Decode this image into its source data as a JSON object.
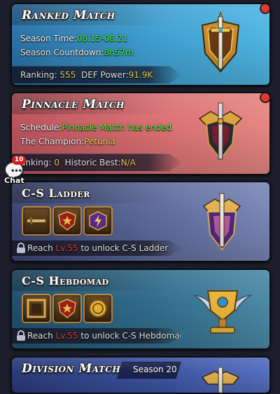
{
  "ranked": {
    "title": "Ranked Match",
    "season_time_label": "Season Time:",
    "season_time_value": "08.15-08.21",
    "countdown_label": "Season Countdown:",
    "countdown_value": "8h57m",
    "ranking_label": "Ranking:",
    "ranking_value": "555",
    "def_label": "DEF Power:",
    "def_value": "91.9K"
  },
  "pinnacle": {
    "title": "Pinnacle Match",
    "schedule_label": "Schedule:",
    "schedule_value": "Pinnacle Match has ended",
    "champion_label": "The Champion:",
    "champion_value": "Petunia",
    "ranking_label": "anking:",
    "ranking_value": "0",
    "best_label": "Historic Best:",
    "best_value": "N/A"
  },
  "ladder": {
    "title": "C-S Ladder",
    "reach_prefix": "Reach",
    "level": "Lv.55",
    "reach_suffix": "to unlock C-S Ladder",
    "icons": [
      "sword-reward-icon",
      "star-shield-icon",
      "lightning-icon"
    ]
  },
  "hebdo": {
    "title": "C-S Hebdomad",
    "reach_prefix": "Reach",
    "level": "Lv.55",
    "reach_suffix": "to unlock C-S Hebdomad",
    "icons": [
      "frame-reward-icon",
      "star-shield-icon",
      "gold-coin-icon"
    ]
  },
  "division": {
    "title": "Division Match",
    "season": "Season 20"
  },
  "chat": {
    "label": "Chat",
    "badge": "10"
  },
  "colors": {
    "green": "#4cff3c",
    "yellow": "#ffe266",
    "red": "#ff4a3d",
    "notification": "#e0251d"
  }
}
